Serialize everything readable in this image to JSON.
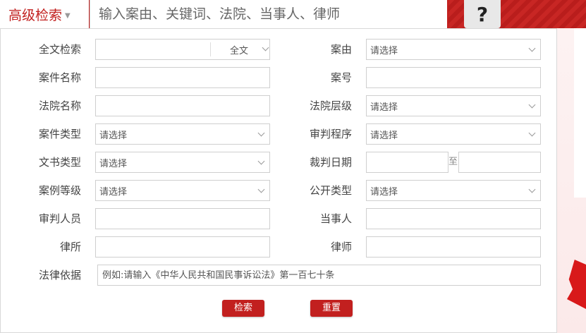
{
  "header": {
    "advanced_label": "高级检索",
    "search_placeholder": "输入案由、关键词、法院、当事人、律师",
    "help_label": "?"
  },
  "form": {
    "full_text": {
      "label": "全文检索",
      "scope": "全文"
    },
    "cause": {
      "label": "案由",
      "value": "请选择"
    },
    "case_name": {
      "label": "案件名称"
    },
    "case_no": {
      "label": "案号"
    },
    "court_name": {
      "label": "法院名称"
    },
    "court_level": {
      "label": "法院层级",
      "value": "请选择"
    },
    "case_type": {
      "label": "案件类型",
      "value": "请选择"
    },
    "procedure": {
      "label": "审判程序",
      "value": "请选择"
    },
    "doc_type": {
      "label": "文书类型",
      "value": "请选择"
    },
    "judgment_date": {
      "label": "裁判日期",
      "to": "至"
    },
    "case_level": {
      "label": "案例等级",
      "value": "请选择"
    },
    "public_type": {
      "label": "公开类型",
      "value": "请选择"
    },
    "judge": {
      "label": "审判人员"
    },
    "party": {
      "label": "当事人"
    },
    "law_firm": {
      "label": "律所"
    },
    "lawyer": {
      "label": "律师"
    },
    "legal_basis": {
      "label": "法律依据",
      "placeholder": "例如:请输入《中华人民共和国民事诉讼法》第一百七十条"
    }
  },
  "buttons": {
    "search": "检索",
    "reset": "重置"
  }
}
